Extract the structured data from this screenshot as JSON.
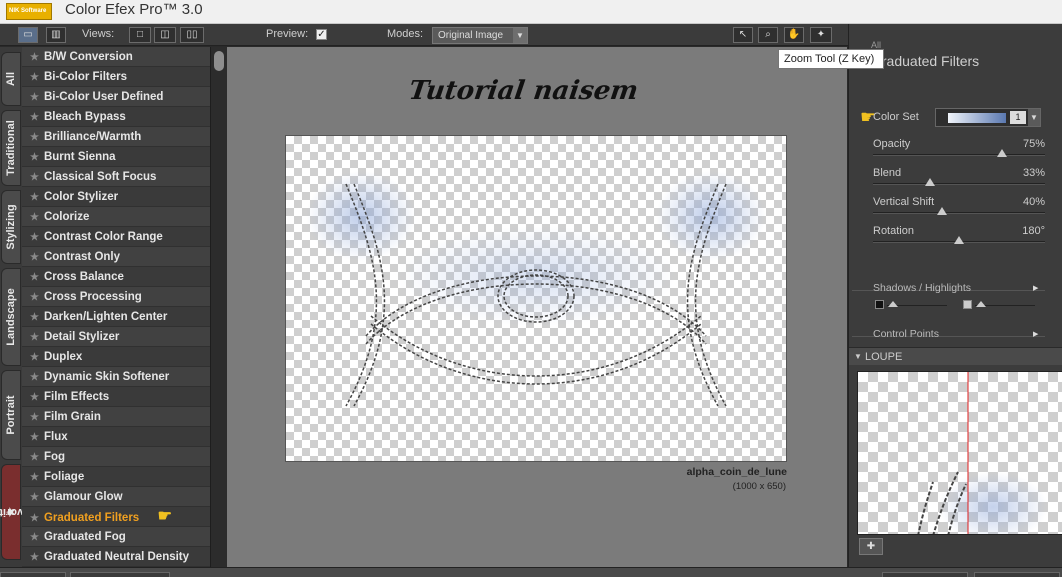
{
  "app": {
    "logo_text": "NIK Software",
    "title": "Color Efex Pro™ 3.0"
  },
  "toolbar": {
    "views_label": "Views:",
    "preview_label": "Preview:",
    "preview_checked": true,
    "modes_label": "Modes:",
    "modes_value": "Original Image",
    "tools": [
      "pointer-icon",
      "zoom-icon",
      "hand-icon",
      "light-icon"
    ]
  },
  "tooltip": {
    "text": "Zoom Tool (Z Key)"
  },
  "vertical_tabs": [
    "All",
    "Traditional",
    "Stylizing",
    "Landscape",
    "Portrait",
    "Favorites"
  ],
  "filters": {
    "selected": "Graduated Filters",
    "items": [
      "B/W Conversion",
      "Bi-Color Filters",
      "Bi-Color User Defined",
      "Bleach Bypass",
      "Brilliance/Warmth",
      "Burnt Sienna",
      "Classical Soft Focus",
      "Color Stylizer",
      "Colorize",
      "Contrast Color Range",
      "Contrast Only",
      "Cross Balance",
      "Cross Processing",
      "Darken/Lighten Center",
      "Detail Stylizer",
      "Duplex",
      "Dynamic Skin Softener",
      "Film Effects",
      "Film Grain",
      "Flux",
      "Fog",
      "Foliage",
      "Glamour Glow",
      "Graduated Filters",
      "Graduated Fog",
      "Graduated Neutral Density"
    ]
  },
  "canvas": {
    "watermark": "Tutorial naisem",
    "image_name": "alpha_coin_de_lune",
    "image_size": "(1000 x 650)"
  },
  "panel": {
    "all_label": "All",
    "title": "Graduated Filters",
    "color_set_label": "Color Set",
    "color_set_value": "1",
    "color_set_gradient": [
      "#f0f4fa",
      "#5a78b0"
    ],
    "sliders": [
      {
        "name": "Opacity",
        "value": "75%",
        "level": 0.75
      },
      {
        "name": "Blend",
        "value": "33%",
        "level": 0.33
      },
      {
        "name": "Vertical Shift",
        "value": "40%",
        "level": 0.4
      },
      {
        "name": "Rotation",
        "value": "180°",
        "level": 0.5
      }
    ],
    "shadows_label": "Shadows / Highlights",
    "control_points_label": "Control Points",
    "loupe_label": "LOUPE"
  },
  "colors": {
    "accent": "#f0a020",
    "panel_bg": "#3c3c3c",
    "canvas_bg": "#7b7b7b"
  }
}
